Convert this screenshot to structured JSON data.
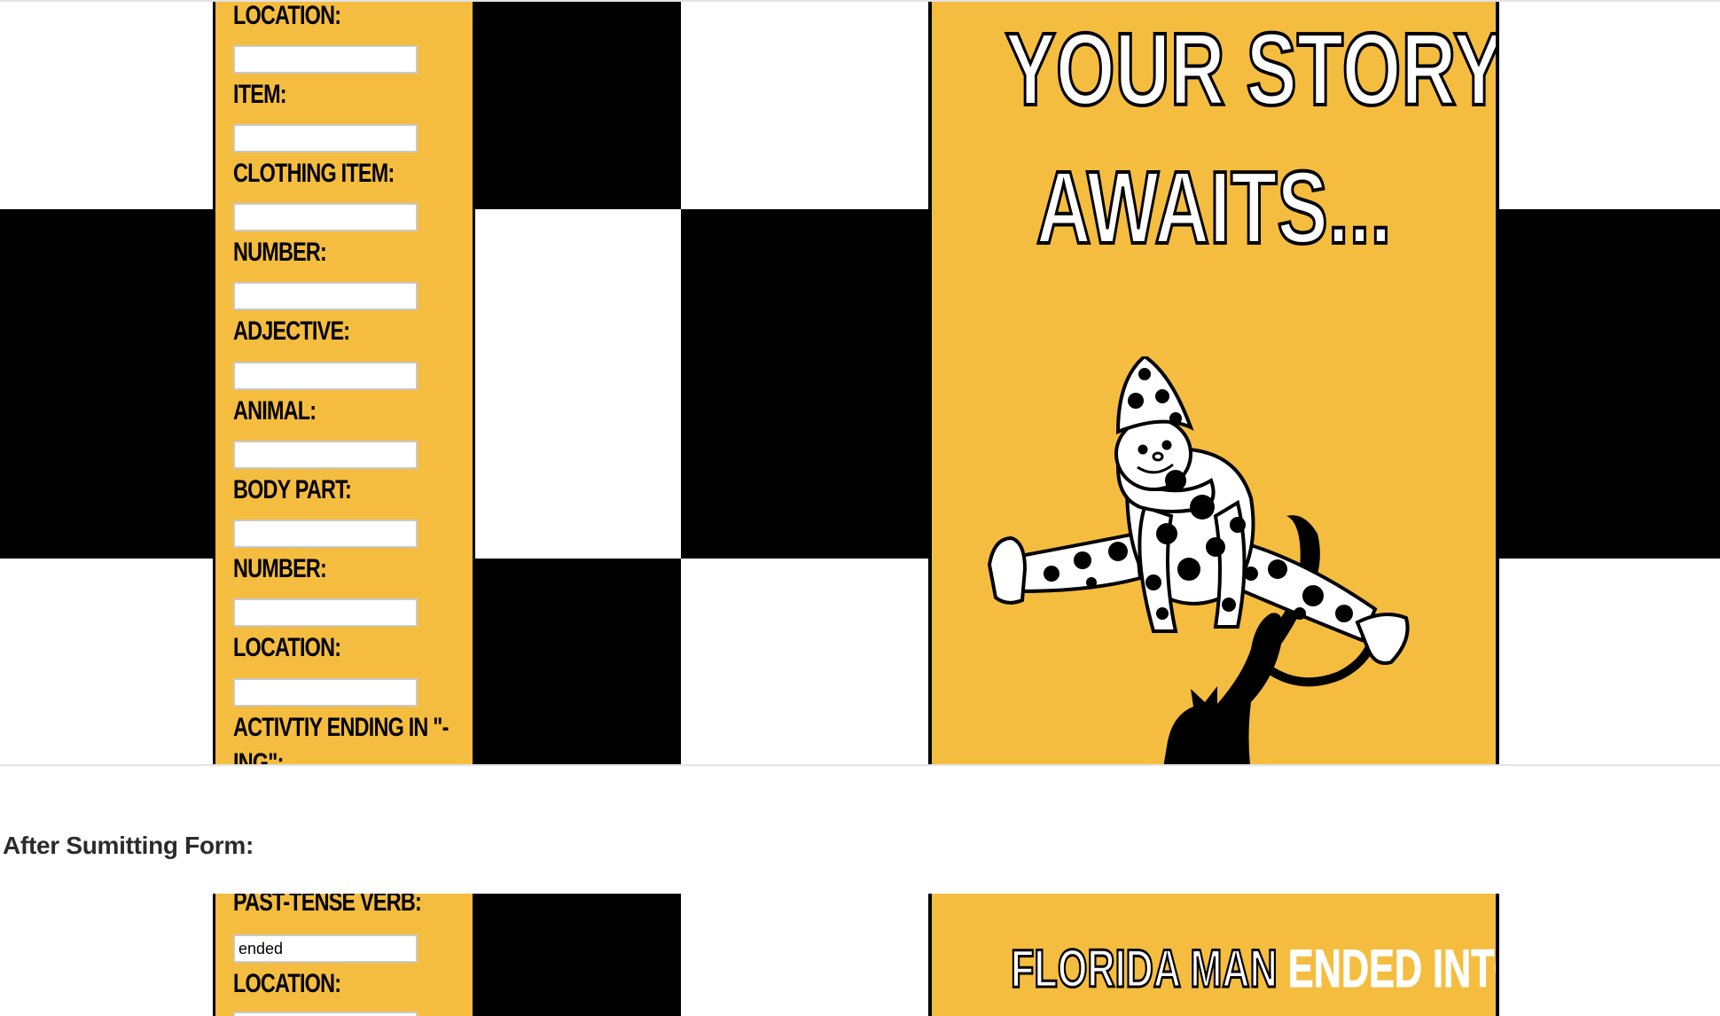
{
  "before": {
    "fields": [
      {
        "label": "Location:",
        "value": ""
      },
      {
        "label": "Item:",
        "value": ""
      },
      {
        "label": "Clothing Item:",
        "value": ""
      },
      {
        "label": "Number:",
        "value": ""
      },
      {
        "label": "Adjective:",
        "value": ""
      },
      {
        "label": "Animal:",
        "value": ""
      },
      {
        "label": "Body Part:",
        "value": ""
      },
      {
        "label": "Number:",
        "value": ""
      },
      {
        "label": "Location:",
        "value": ""
      },
      {
        "label": "Activtiy ending in \"-ing\":",
        "value": ""
      }
    ],
    "poster": {
      "line1": "Your Story",
      "line2": "Awaits...",
      "illustration_icon": "clown-leaping-over-cat-illustration"
    }
  },
  "section_heading": "After Sumitting Form:",
  "after": {
    "fields": [
      {
        "label": "Past-Tense Verb:",
        "value": "ended"
      },
      {
        "label": "Location:",
        "value": ""
      }
    ],
    "story": {
      "fixed_start": "Florida Man",
      "filled": "ended",
      "fixed_end": "into a"
    }
  },
  "colors": {
    "panel_yellow": "#f5bd3f",
    "block_black": "#000000",
    "outline": "#000000",
    "heading_text": "#2b2b2b"
  }
}
